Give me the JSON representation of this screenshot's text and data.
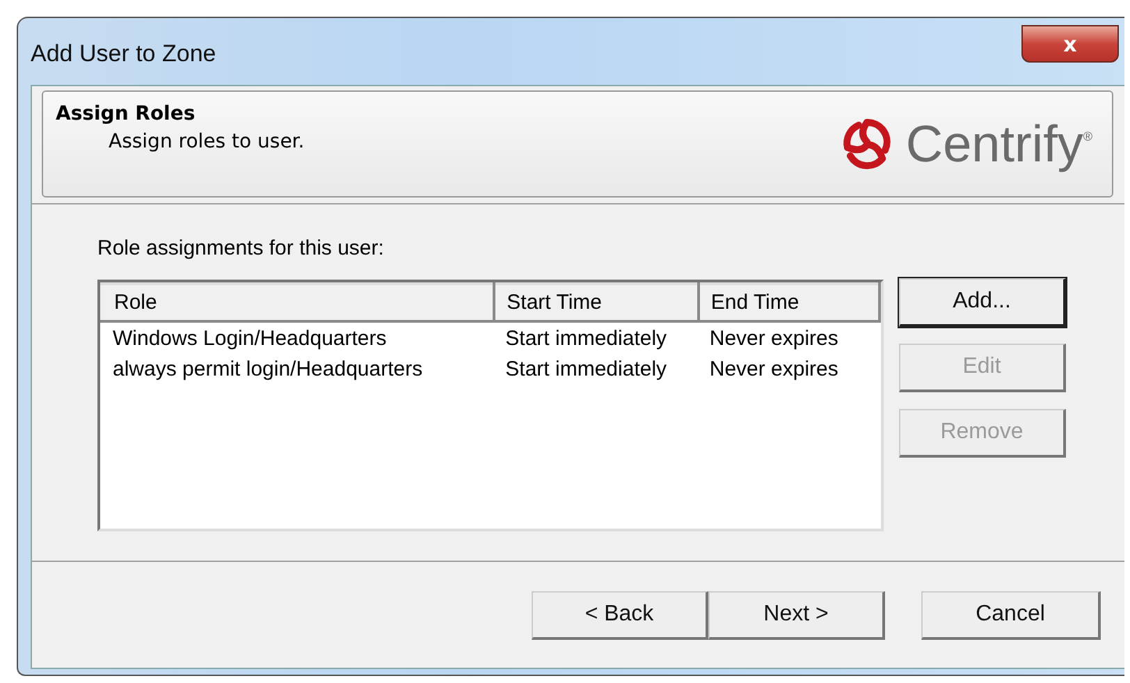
{
  "window": {
    "title": "Add User to Zone",
    "close_glyph": "x"
  },
  "header": {
    "title": "Assign Roles",
    "subtitle": "Assign roles to user.",
    "logo": "Centrify$^{®}$"
  },
  "list_label": "Role assignments for this user:",
  "table": {
    "columns": [
      "Role",
      "Start Time",
      "End Time"
    ],
    "rows": [
      [
        "Windows Login/Headquarters",
        "Start immediately",
        "Never expires"
      ],
      [
        "always permit login/Headquarters",
        "Start immediately",
        "Never expires"
      ]
    ]
  },
  "side_buttons": [
    {
      "label": "Add...",
      "disabled": false,
      "default": true
    },
    {
      "label": "Edit",
      "disabled": true,
      "default": false
    },
    {
      "label": "Remove",
      "disabled": true,
      "default": false
    }
  ],
  "nav_buttons": [
    {
      "label": "< Back",
      "disabled": false
    },
    {
      "label": "Next >",
      "disabled": false
    }
  ],
  "cancel_button": {
    "label": "Cancel",
    "disabled": false
  }
}
